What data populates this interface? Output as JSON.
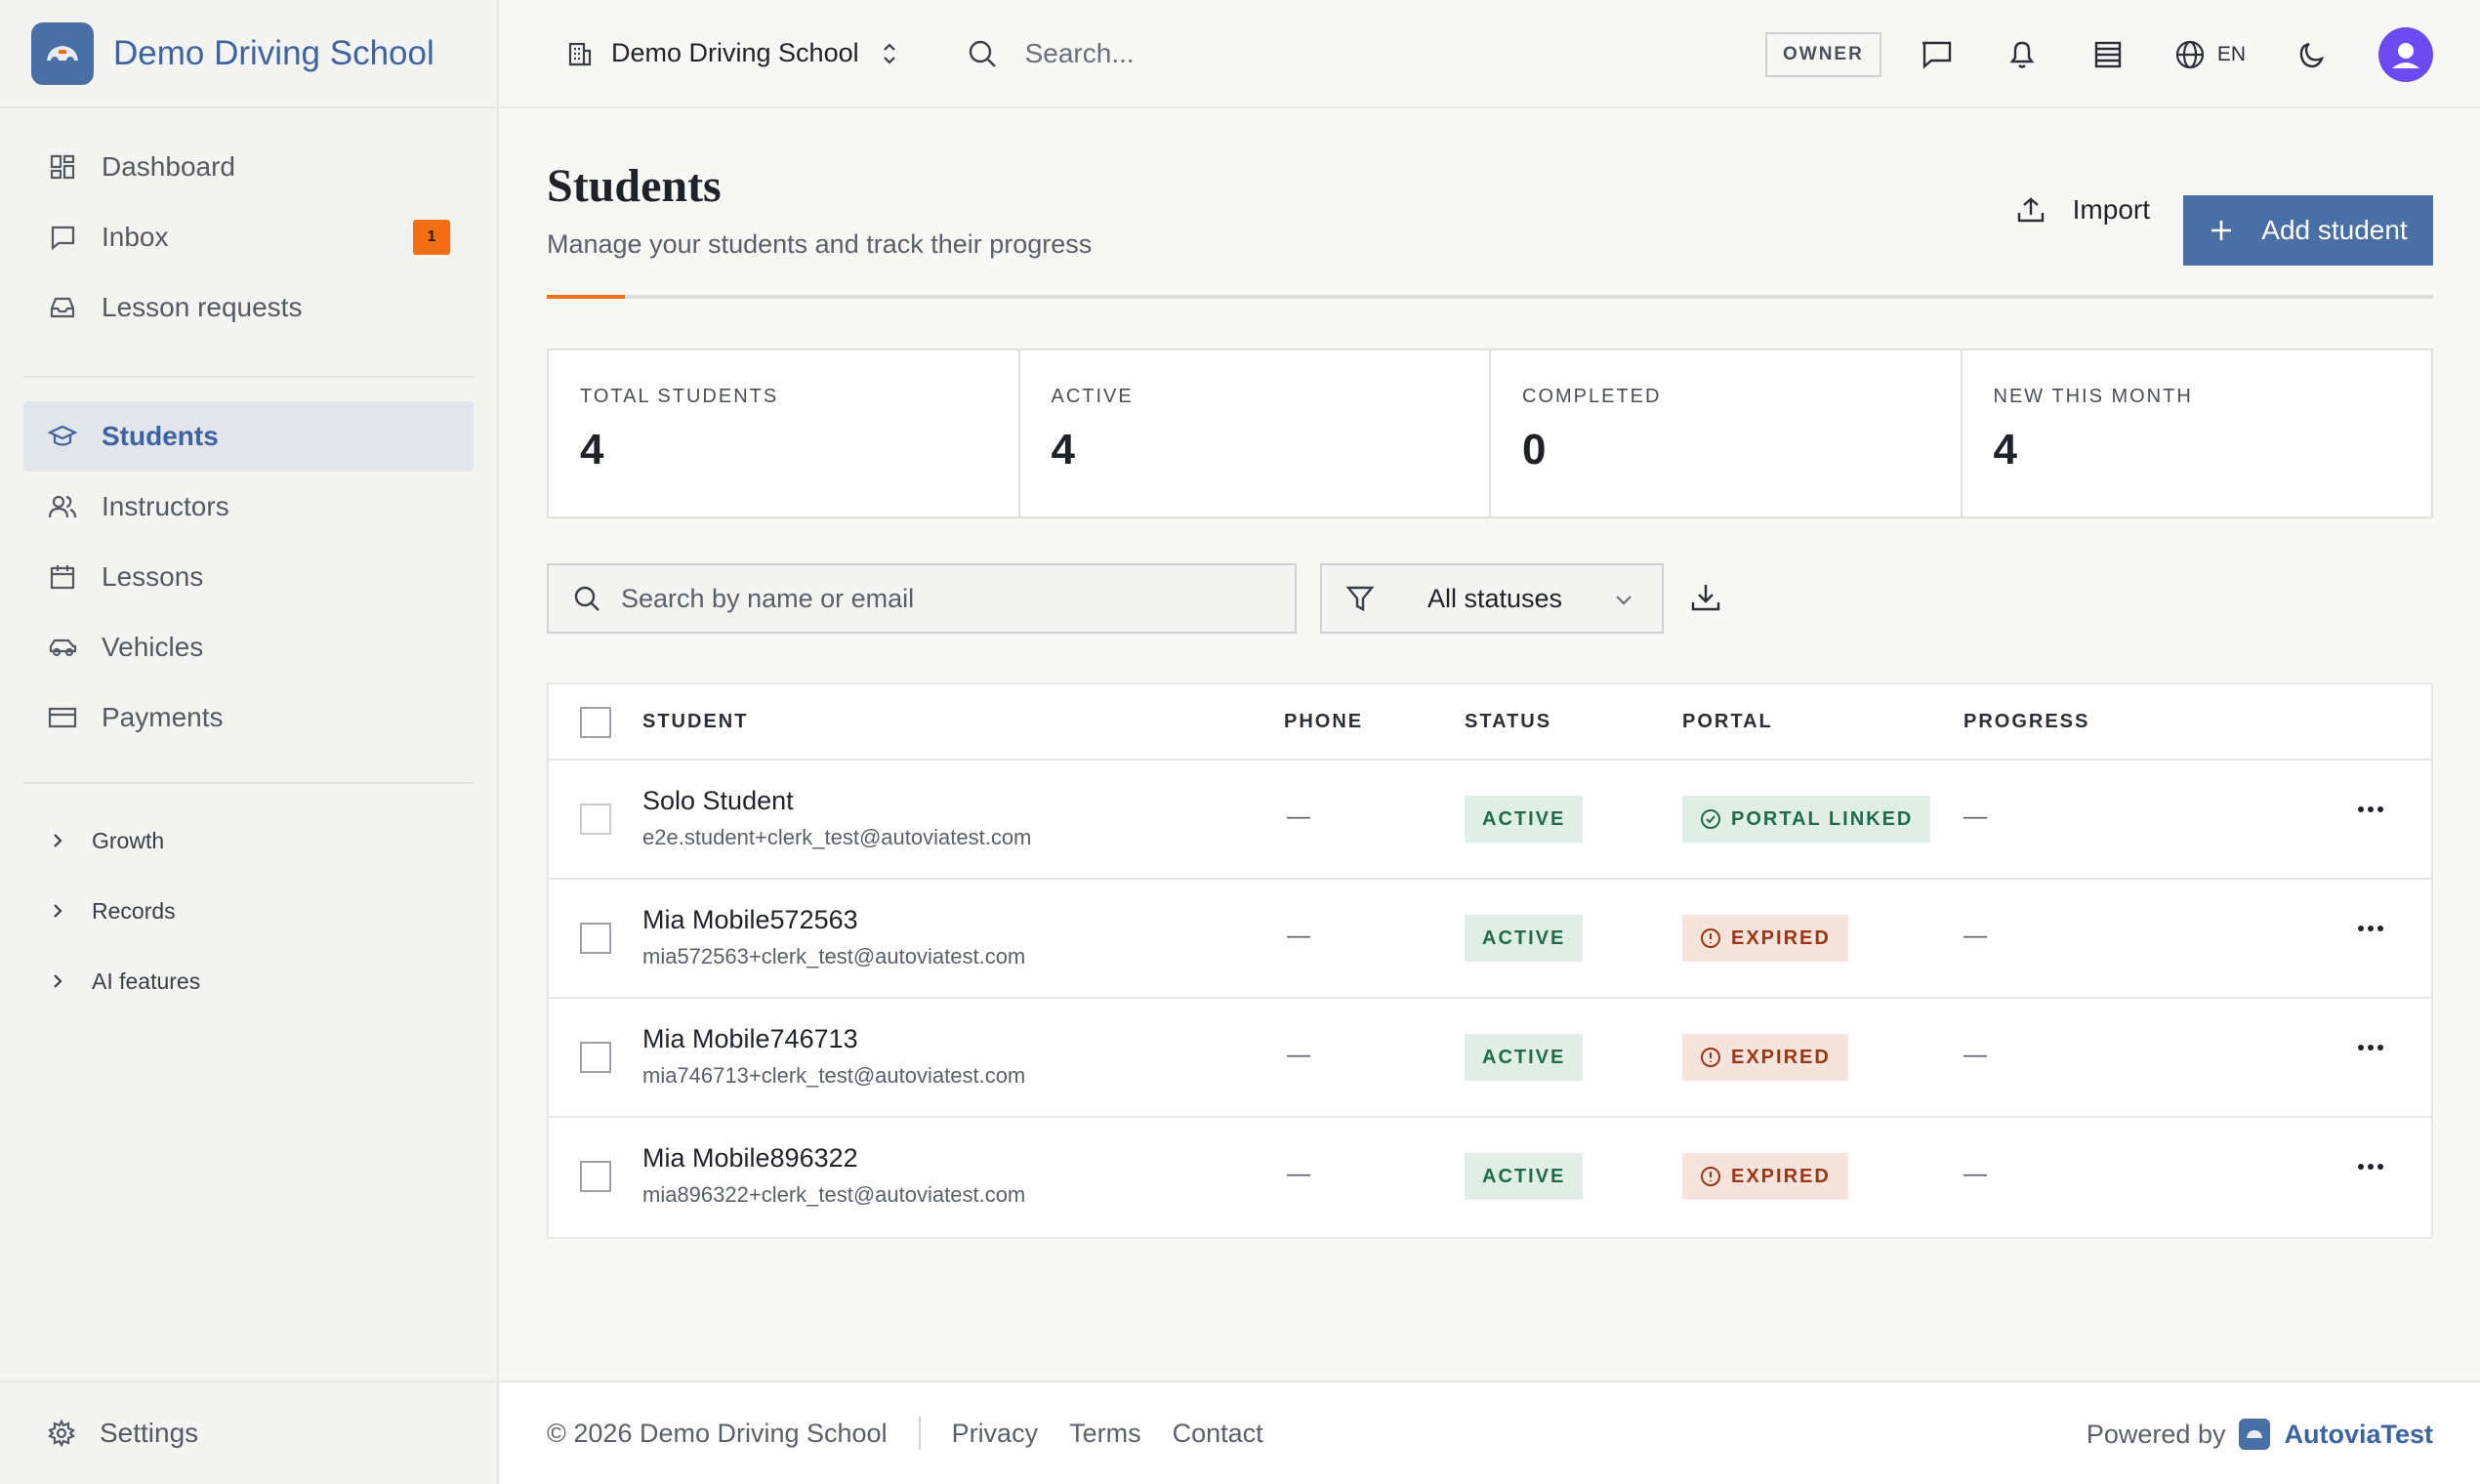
{
  "brand": {
    "name": "Demo Driving School"
  },
  "sidebar": {
    "items": [
      {
        "label": "Dashboard"
      },
      {
        "label": "Inbox",
        "badge": "1"
      },
      {
        "label": "Lesson requests"
      },
      {
        "label": "Students"
      },
      {
        "label": "Instructors"
      },
      {
        "label": "Lessons"
      },
      {
        "label": "Vehicles"
      },
      {
        "label": "Payments"
      }
    ],
    "groups": [
      {
        "label": "Growth"
      },
      {
        "label": "Records"
      },
      {
        "label": "AI features"
      }
    ],
    "settings_label": "Settings"
  },
  "topbar": {
    "school": "Demo Driving School",
    "search_placeholder": "Search...",
    "role": "OWNER",
    "language": "EN"
  },
  "page": {
    "title": "Students",
    "subtitle": "Manage your students and track their progress",
    "import_label": "Import",
    "add_label": "Add student"
  },
  "stats": [
    {
      "label": "TOTAL STUDENTS",
      "value": "4"
    },
    {
      "label": "ACTIVE",
      "value": "4"
    },
    {
      "label": "COMPLETED",
      "value": "0"
    },
    {
      "label": "NEW THIS MONTH",
      "value": "4"
    }
  ],
  "filters": {
    "search_placeholder": "Search by name or email",
    "status_selected": "All statuses"
  },
  "table": {
    "columns": [
      "STUDENT",
      "PHONE",
      "STATUS",
      "PORTAL",
      "PROGRESS"
    ],
    "rows": [
      {
        "name": "Solo Student",
        "email": "e2e.student+clerk_test@autoviatest.com",
        "phone": "—",
        "status": "ACTIVE",
        "portal": "PORTAL LINKED",
        "progress": "—"
      },
      {
        "name": "Mia Mobile572563",
        "email": "mia572563+clerk_test@autoviatest.com",
        "phone": "—",
        "status": "ACTIVE",
        "portal": "EXPIRED",
        "progress": "—"
      },
      {
        "name": "Mia Mobile746713",
        "email": "mia746713+clerk_test@autoviatest.com",
        "phone": "—",
        "status": "ACTIVE",
        "portal": "EXPIRED",
        "progress": "—"
      },
      {
        "name": "Mia Mobile896322",
        "email": "mia896322+clerk_test@autoviatest.com",
        "phone": "—",
        "status": "ACTIVE",
        "portal": "EXPIRED",
        "progress": "—"
      }
    ]
  },
  "footer": {
    "copyright": "© 2026 Demo Driving School",
    "links": [
      "Privacy",
      "Terms",
      "Contact"
    ],
    "powered_by": "Powered by",
    "powered_brand": "AutoviaTest"
  },
  "colors": {
    "accent": "#4a6fa5",
    "brand_text": "#3d63a1",
    "orange": "#f36d12",
    "avatar": "#6c4bf2"
  }
}
